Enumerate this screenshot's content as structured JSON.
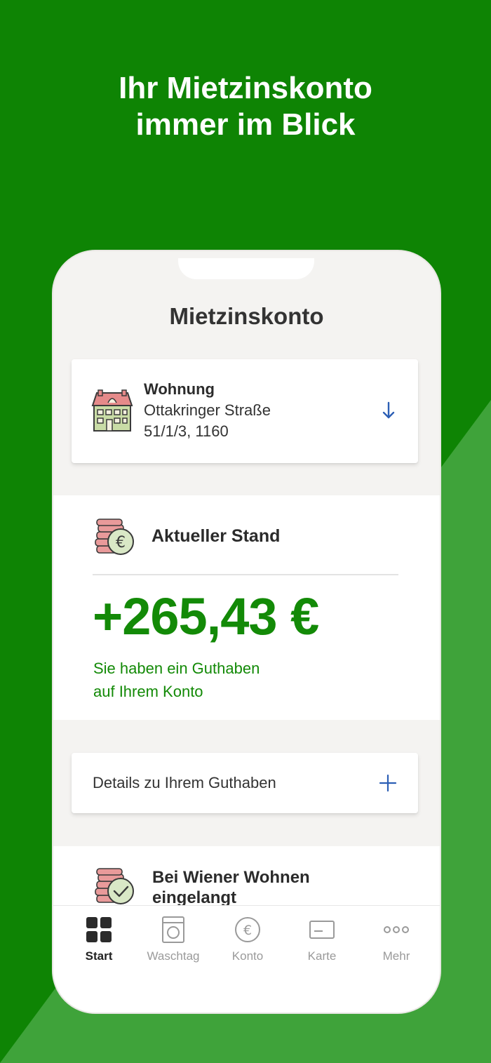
{
  "headline": {
    "line1": "Ihr Mietzinskonto",
    "line2": "immer im Blick"
  },
  "colors": {
    "brand_green": "#0e8404",
    "light_green": "#3fa33a",
    "amount_green": "#138a07",
    "accent_blue": "#2c5fb5"
  },
  "screen": {
    "title": "Mietzinskonto"
  },
  "apartment": {
    "icon": "house-icon",
    "title": "Wohnung",
    "address_line1": "Ottakringer Straße",
    "address_line2": "51/1/3, 1160",
    "toggle_icon": "arrow-down-icon"
  },
  "balance": {
    "icon": "coins-euro-icon",
    "label": "Aktueller Stand",
    "amount": "+265,43 €",
    "note_line1": "Sie haben ein Guthaben",
    "note_line2": "auf Ihrem Konto"
  },
  "details": {
    "label": "Details zu Ihrem Guthaben",
    "expand_icon": "plus-icon"
  },
  "registered": {
    "icon": "coins-check-icon",
    "label_line1": "Bei Wiener Wohnen",
    "label_line2": "eingelangt"
  },
  "tabbar": {
    "tabs": [
      {
        "label": "Start",
        "icon": "grid-icon",
        "active": true
      },
      {
        "label": "Waschtag",
        "icon": "washing-machine-icon",
        "active": false
      },
      {
        "label": "Konto",
        "icon": "euro-icon",
        "active": false
      },
      {
        "label": "Karte",
        "icon": "card-icon",
        "active": false
      },
      {
        "label": "Mehr",
        "icon": "more-icon",
        "active": false
      }
    ]
  }
}
